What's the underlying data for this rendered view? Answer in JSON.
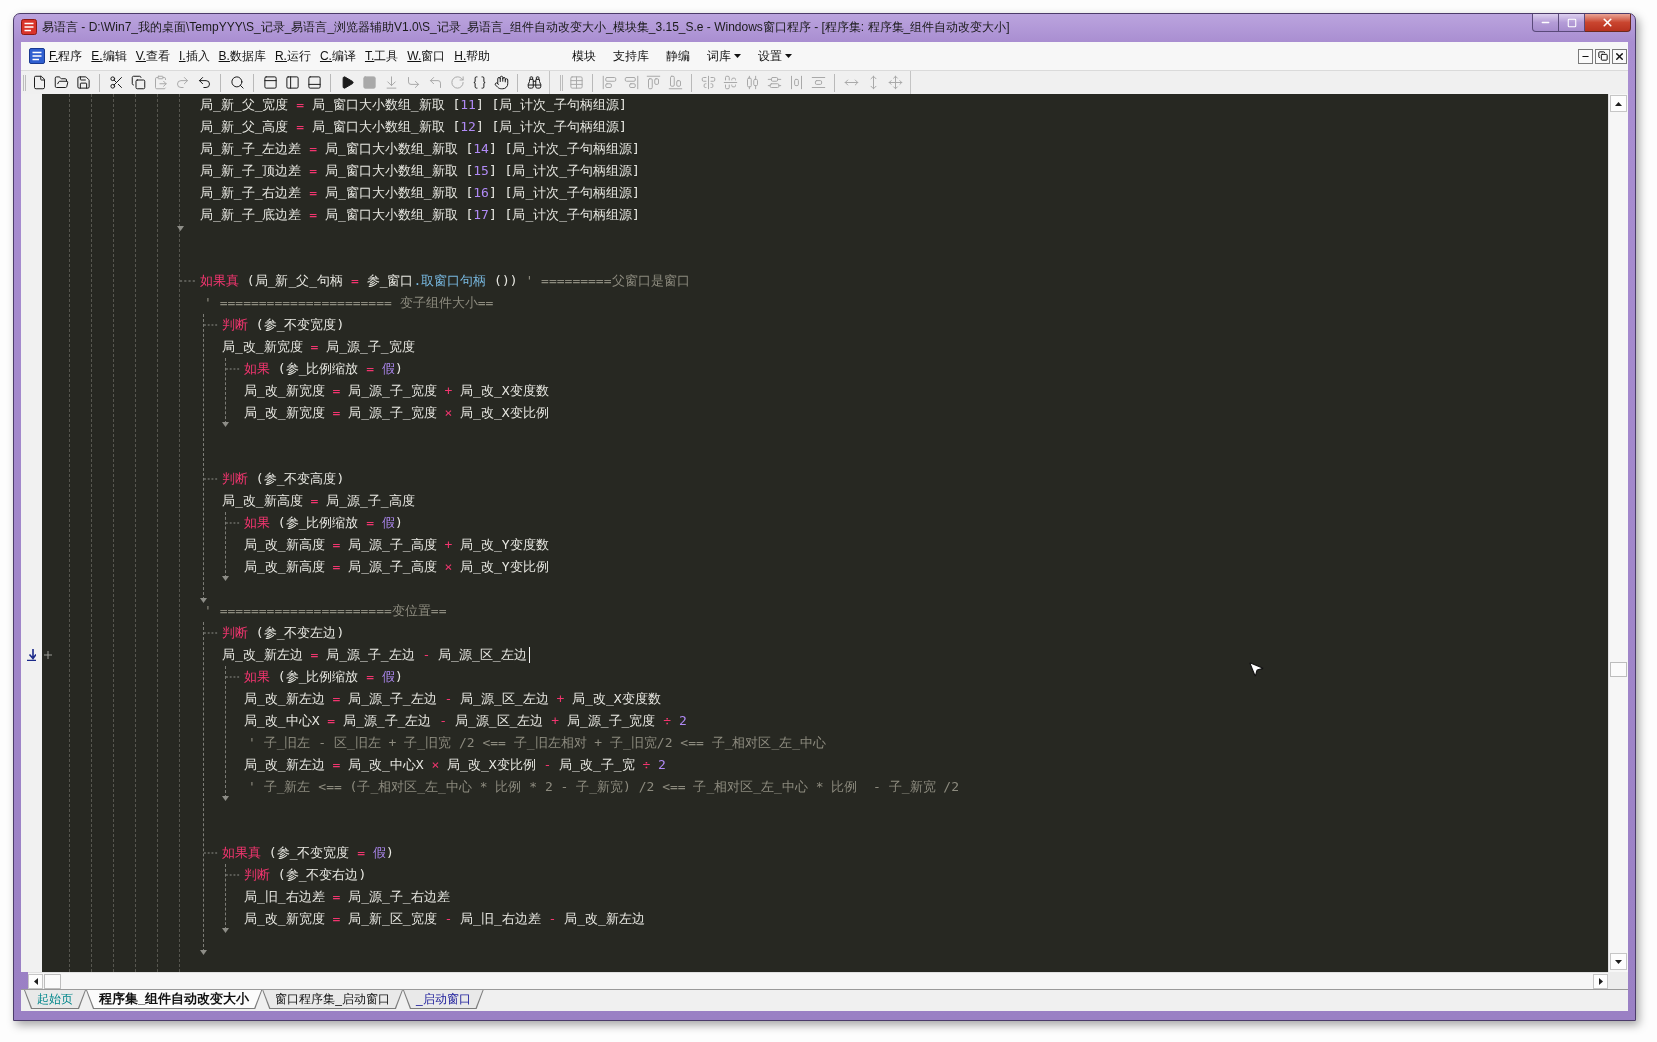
{
  "window": {
    "title": "易语言 - D:\\Win7_我的桌面\\TempYYY\\S_记录_易语言_浏览器辅助V1.0\\S_记录_易语言_组件自动改变大小_模块集_3.15_S.e - Windows窗口程序 - [程序集: 程序集_组件自动改变大小]"
  },
  "menu_bar": {
    "items": [
      "F.程序",
      "E.编辑",
      "V.查看",
      "I.插入",
      "B.数据库",
      "R.运行",
      "C.编译",
      "T.工具",
      "W.窗口",
      "H.帮助"
    ],
    "extras": [
      {
        "label": "模块",
        "dropdown": false
      },
      {
        "label": "支持库",
        "dropdown": false
      },
      {
        "label": "静编",
        "dropdown": false
      },
      {
        "label": "词库",
        "dropdown": true
      },
      {
        "label": "设置",
        "dropdown": true
      }
    ]
  },
  "toolbars": [
    {
      "groups": [
        {
          "buttons": [
            {
              "kind": "new",
              "disabled": false
            },
            {
              "kind": "open",
              "disabled": false
            },
            {
              "kind": "save",
              "disabled": false
            }
          ]
        },
        {
          "buttons": [
            {
              "kind": "cut",
              "disabled": false
            },
            {
              "kind": "copy",
              "disabled": false
            },
            {
              "kind": "paste",
              "disabled": true
            },
            {
              "kind": "redo",
              "disabled": true
            },
            {
              "kind": "undo",
              "disabled": false
            }
          ]
        },
        {
          "buttons": [
            {
              "kind": "find",
              "disabled": false
            }
          ]
        },
        {
          "buttons": [
            {
              "kind": "layout_top",
              "disabled": false
            },
            {
              "kind": "layout_left",
              "disabled": false
            },
            {
              "kind": "layout_bottom",
              "disabled": false
            }
          ]
        },
        {
          "buttons": [
            {
              "kind": "run",
              "disabled": false
            },
            {
              "kind": "stop",
              "disabled": true
            },
            {
              "kind": "step_into",
              "disabled": true
            },
            {
              "kind": "step_over",
              "disabled": true
            },
            {
              "kind": "step_out",
              "disabled": true
            },
            {
              "kind": "run_to_cursor",
              "disabled": true
            },
            {
              "kind": "braces",
              "disabled": false
            },
            {
              "kind": "hand",
              "disabled": false
            }
          ]
        },
        {
          "buttons": [
            {
              "kind": "binoculars",
              "disabled": false
            }
          ]
        }
      ]
    },
    {
      "groups": [
        {
          "buttons": [
            {
              "kind": "grid",
              "disabled": true
            }
          ]
        },
        {
          "buttons": [
            {
              "kind": "align_left",
              "disabled": true
            },
            {
              "kind": "align_right",
              "disabled": true
            },
            {
              "kind": "align_top",
              "disabled": true
            },
            {
              "kind": "align_bottom",
              "disabled": true
            }
          ]
        },
        {
          "buttons": [
            {
              "kind": "center_vertical",
              "disabled": true
            },
            {
              "kind": "center_horizontal",
              "disabled": true
            },
            {
              "kind": "distribute_horizontal",
              "disabled": true
            },
            {
              "kind": "distribute_vertical",
              "disabled": true
            },
            {
              "kind": "space_horizontal",
              "disabled": true
            },
            {
              "kind": "space_vertical",
              "disabled": true
            }
          ]
        },
        {
          "buttons": [
            {
              "kind": "same_width",
              "disabled": true
            },
            {
              "kind": "same_height",
              "disabled": true
            },
            {
              "kind": "same_size",
              "disabled": true
            }
          ]
        }
      ]
    }
  ],
  "editor": {
    "lines": [
      {
        "kind": "code",
        "current": false,
        "tokens": [
          {
            "text": "局_新_父_宽度",
            "kind": "text"
          },
          {
            "text": "=",
            "kind": "operator"
          },
          {
            "text": "局_窗口大小数组_新取",
            "kind": "text"
          },
          {
            "text": "[",
            "kind": "text"
          },
          {
            "text": "11",
            "kind": "number",
            "tight": true
          },
          {
            "text": "]",
            "kind": "text",
            "tight": true
          },
          {
            "text": "[局_计次_子句柄组源]",
            "kind": "text"
          }
        ]
      },
      {
        "kind": "code",
        "current": false,
        "tokens": [
          {
            "text": "局_新_父_高度",
            "kind": "text"
          },
          {
            "text": "=",
            "kind": "operator"
          },
          {
            "text": "局_窗口大小数组_新取",
            "kind": "text"
          },
          {
            "text": "[",
            "kind": "text"
          },
          {
            "text": "12",
            "kind": "number",
            "tight": true
          },
          {
            "text": "]",
            "kind": "text",
            "tight": true
          },
          {
            "text": "[局_计次_子句柄组源]",
            "kind": "text"
          }
        ]
      },
      {
        "kind": "code",
        "current": false,
        "tokens": [
          {
            "text": "局_新_子_左边差",
            "kind": "text"
          },
          {
            "text": "=",
            "kind": "operator"
          },
          {
            "text": "局_窗口大小数组_新取",
            "kind": "text"
          },
          {
            "text": "[",
            "kind": "text"
          },
          {
            "text": "14",
            "kind": "number",
            "tight": true
          },
          {
            "text": "]",
            "kind": "text",
            "tight": true
          },
          {
            "text": "[局_计次_子句柄组源]",
            "kind": "text"
          }
        ]
      },
      {
        "kind": "code",
        "current": false,
        "tokens": [
          {
            "text": "局_新_子_顶边差",
            "kind": "text"
          },
          {
            "text": "=",
            "kind": "operator"
          },
          {
            "text": "局_窗口大小数组_新取",
            "kind": "text"
          },
          {
            "text": "[",
            "kind": "text"
          },
          {
            "text": "15",
            "kind": "number",
            "tight": true
          },
          {
            "text": "]",
            "kind": "text",
            "tight": true
          },
          {
            "text": "[局_计次_子句柄组源]",
            "kind": "text"
          }
        ]
      },
      {
        "kind": "code",
        "current": false,
        "tokens": [
          {
            "text": "局_新_子_右边差",
            "kind": "text"
          },
          {
            "text": "=",
            "kind": "operator"
          },
          {
            "text": "局_窗口大小数组_新取",
            "kind": "text"
          },
          {
            "text": "[",
            "kind": "text"
          },
          {
            "text": "16",
            "kind": "number",
            "tight": true
          },
          {
            "text": "]",
            "kind": "text",
            "tight": true
          },
          {
            "text": "[局_计次_子句柄组源]",
            "kind": "text"
          }
        ]
      },
      {
        "kind": "code",
        "current": false,
        "tokens": [
          {
            "text": "局_新_子_底边差",
            "kind": "text"
          },
          {
            "text": "=",
            "kind": "operator"
          },
          {
            "text": "局_窗口大小数组_新取",
            "kind": "text"
          },
          {
            "text": "[",
            "kind": "text"
          },
          {
            "text": "17",
            "kind": "number",
            "tight": true
          },
          {
            "text": "]",
            "kind": "text",
            "tight": true
          },
          {
            "text": "[局_计次_子句柄组源]",
            "kind": "text"
          }
        ]
      },
      {
        "kind": "end"
      },
      {
        "kind": "blank"
      },
      {
        "kind": "flow",
        "current": false,
        "tokens": [
          {
            "text": "如果真",
            "kind": "keyword"
          },
          {
            "text": "(局_新_父_句柄",
            "kind": "text"
          },
          {
            "text": "=",
            "kind": "operator"
          },
          {
            "text": "参_窗口",
            "kind": "text"
          },
          {
            "text": ".取窗口句柄",
            "kind": "method",
            "tight": true
          },
          {
            "text": "())",
            "kind": "text"
          },
          {
            "text": "' =========父窗口是窗口",
            "kind": "comment"
          }
        ]
      },
      {
        "kind": "comment",
        "current": false,
        "tokens": [
          {
            "text": "' ====================== 变子组件大小==",
            "kind": "comment"
          }
        ],
        "children": [
          {
            "kind": "flow",
            "current": false,
            "tokens": [
              {
                "text": "判断",
                "kind": "keyword"
              },
              {
                "text": "(参_不变宽度)",
                "kind": "text"
              }
            ]
          },
          {
            "kind": "code",
            "current": false,
            "tokens": [
              {
                "text": "局_改_新宽度",
                "kind": "text"
              },
              {
                "text": "=",
                "kind": "operator"
              },
              {
                "text": "局_源_子_宽度",
                "kind": "text"
              }
            ],
            "children": [
              {
                "kind": "flow",
                "current": false,
                "tokens": [
                  {
                    "text": "如果",
                    "kind": "keyword"
                  },
                  {
                    "text": "(参_比例缩放",
                    "kind": "text"
                  },
                  {
                    "text": "=",
                    "kind": "operator"
                  },
                  {
                    "text": "假",
                    "kind": "constant"
                  },
                  {
                    "text": ")",
                    "kind": "text",
                    "tight": true
                  }
                ]
              },
              {
                "kind": "code",
                "current": false,
                "tokens": [
                  {
                    "text": "局_改_新宽度",
                    "kind": "text"
                  },
                  {
                    "text": "=",
                    "kind": "operator"
                  },
                  {
                    "text": "局_源_子_宽度",
                    "kind": "text"
                  },
                  {
                    "text": "+",
                    "kind": "operator"
                  },
                  {
                    "text": "局_改_X变度数",
                    "kind": "text"
                  }
                ]
              },
              {
                "kind": "code",
                "current": false,
                "tokens": [
                  {
                    "text": "局_改_新宽度",
                    "kind": "text"
                  },
                  {
                    "text": "=",
                    "kind": "operator"
                  },
                  {
                    "text": "局_源_子_宽度",
                    "kind": "text"
                  },
                  {
                    "text": "×",
                    "kind": "operator"
                  },
                  {
                    "text": "局_改_X变比例",
                    "kind": "text"
                  }
                ]
              }
            ]
          },
          {
            "kind": "blank"
          },
          {
            "kind": "blank"
          },
          {
            "kind": "flow",
            "current": false,
            "tokens": [
              {
                "text": "判断",
                "kind": "keyword"
              },
              {
                "text": "(参_不变高度)",
                "kind": "text"
              }
            ]
          },
          {
            "kind": "code",
            "current": false,
            "tokens": [
              {
                "text": "局_改_新高度",
                "kind": "text"
              },
              {
                "text": "=",
                "kind": "operator"
              },
              {
                "text": "局_源_子_高度",
                "kind": "text"
              }
            ],
            "children": [
              {
                "kind": "flow",
                "current": false,
                "tokens": [
                  {
                    "text": "如果",
                    "kind": "keyword"
                  },
                  {
                    "text": "(参_比例缩放",
                    "kind": "text"
                  },
                  {
                    "text": "=",
                    "kind": "operator"
                  },
                  {
                    "text": "假",
                    "kind": "constant"
                  },
                  {
                    "text": ")",
                    "kind": "text",
                    "tight": true
                  }
                ]
              },
              {
                "kind": "code",
                "current": false,
                "tokens": [
                  {
                    "text": "局_改_新高度",
                    "kind": "text"
                  },
                  {
                    "text": "=",
                    "kind": "operator"
                  },
                  {
                    "text": "局_源_子_高度",
                    "kind": "text"
                  },
                  {
                    "text": "+",
                    "kind": "operator"
                  },
                  {
                    "text": "局_改_Y变度数",
                    "kind": "text"
                  }
                ]
              },
              {
                "kind": "code",
                "current": false,
                "tokens": [
                  {
                    "text": "局_改_新高度",
                    "kind": "text"
                  },
                  {
                    "text": "=",
                    "kind": "operator"
                  },
                  {
                    "text": "局_源_子_高度",
                    "kind": "text"
                  },
                  {
                    "text": "×",
                    "kind": "operator"
                  },
                  {
                    "text": "局_改_Y变比例",
                    "kind": "text"
                  }
                ]
              }
            ]
          },
          {
            "kind": "blank"
          }
        ]
      },
      {
        "kind": "comment",
        "current": false,
        "tokens": [
          {
            "text": "' ======================变位置==",
            "kind": "comment"
          }
        ],
        "children": [
          {
            "kind": "flow",
            "current": false,
            "tokens": [
              {
                "text": "判断",
                "kind": "keyword"
              },
              {
                "text": "(参_不变左边)",
                "kind": "text"
              }
            ]
          },
          {
            "kind": "code",
            "current": true,
            "tokens": [
              {
                "text": "局_改_新左边",
                "kind": "text"
              },
              {
                "text": "=",
                "kind": "operator"
              },
              {
                "text": "局_源_子_左边",
                "kind": "text"
              },
              {
                "text": "-",
                "kind": "operator"
              },
              {
                "text": "局_源_区_左边",
                "kind": "text"
              }
            ],
            "children": [
              {
                "kind": "flow",
                "current": false,
                "tokens": [
                  {
                    "text": "如果",
                    "kind": "keyword"
                  },
                  {
                    "text": "(参_比例缩放",
                    "kind": "text"
                  },
                  {
                    "text": "=",
                    "kind": "operator"
                  },
                  {
                    "text": "假",
                    "kind": "constant"
                  },
                  {
                    "text": ")",
                    "kind": "text",
                    "tight": true
                  }
                ]
              },
              {
                "kind": "code",
                "current": false,
                "tokens": [
                  {
                    "text": "局_改_新左边",
                    "kind": "text"
                  },
                  {
                    "text": "=",
                    "kind": "operator"
                  },
                  {
                    "text": "局_源_子_左边",
                    "kind": "text"
                  },
                  {
                    "text": "-",
                    "kind": "operator"
                  },
                  {
                    "text": "局_源_区_左边",
                    "kind": "text"
                  },
                  {
                    "text": "+",
                    "kind": "operator"
                  },
                  {
                    "text": "局_改_X变度数",
                    "kind": "text"
                  }
                ]
              },
              {
                "kind": "code",
                "current": false,
                "tokens": [
                  {
                    "text": "局_改_中心X",
                    "kind": "text"
                  },
                  {
                    "text": "=",
                    "kind": "operator"
                  },
                  {
                    "text": "局_源_子_左边",
                    "kind": "text"
                  },
                  {
                    "text": "-",
                    "kind": "operator"
                  },
                  {
                    "text": "局_源_区_左边",
                    "kind": "text"
                  },
                  {
                    "text": "+",
                    "kind": "operator"
                  },
                  {
                    "text": "局_源_子_宽度",
                    "kind": "text"
                  },
                  {
                    "text": "÷",
                    "kind": "operator"
                  },
                  {
                    "text": "2",
                    "kind": "number"
                  }
                ]
              },
              {
                "kind": "comment",
                "current": false,
                "tokens": [
                  {
                    "text": "' 子_旧左 - 区_旧左 + 子_旧宽 /2 <== 子_旧左相对 + 子_旧宽/2 <== 子_相对区_左_中心",
                    "kind": "comment"
                  }
                ]
              },
              {
                "kind": "code",
                "current": false,
                "tokens": [
                  {
                    "text": "局_改_新左边",
                    "kind": "text"
                  },
                  {
                    "text": "=",
                    "kind": "operator"
                  },
                  {
                    "text": "局_改_中心X",
                    "kind": "text"
                  },
                  {
                    "text": "×",
                    "kind": "operator"
                  },
                  {
                    "text": "局_改_X变比例",
                    "kind": "text"
                  },
                  {
                    "text": "-",
                    "kind": "operator"
                  },
                  {
                    "text": "局_改_子_宽",
                    "kind": "text"
                  },
                  {
                    "text": "÷",
                    "kind": "operator"
                  },
                  {
                    "text": "2",
                    "kind": "number"
                  }
                ]
              },
              {
                "kind": "comment",
                "current": false,
                "tokens": [
                  {
                    "text": "' 子_新左 <== (子_相对区_左_中心 * 比例 * 2 - 子_新宽) /2 <== 子_相对区_左_中心 * 比例  - 子_新宽 /2",
                    "kind": "comment"
                  }
                ]
              }
            ]
          },
          {
            "kind": "blank"
          },
          {
            "kind": "blank"
          },
          {
            "kind": "flow",
            "current": false,
            "tokens": [
              {
                "text": "如果真",
                "kind": "keyword"
              },
              {
                "text": "(参_不变宽度",
                "kind": "text"
              },
              {
                "text": "=",
                "kind": "operator"
              },
              {
                "text": "假",
                "kind": "constant"
              },
              {
                "text": ")",
                "kind": "text",
                "tight": true
              }
            ],
            "children": [
              {
                "kind": "flow",
                "current": false,
                "tokens": [
                  {
                    "text": "判断",
                    "kind": "keyword"
                  },
                  {
                    "text": "(参_不变右边)",
                    "kind": "text"
                  }
                ]
              },
              {
                "kind": "code",
                "current": false,
                "tokens": [
                  {
                    "text": "局_旧_右边差",
                    "kind": "text"
                  },
                  {
                    "text": "=",
                    "kind": "operator"
                  },
                  {
                    "text": "局_源_子_右边差",
                    "kind": "text"
                  }
                ]
              },
              {
                "kind": "code",
                "current": false,
                "tokens": [
                  {
                    "text": "局_改_新宽度",
                    "kind": "text"
                  },
                  {
                    "text": "=",
                    "kind": "operator"
                  },
                  {
                    "text": "局_新_区_宽度",
                    "kind": "text"
                  },
                  {
                    "text": "-",
                    "kind": "operator"
                  },
                  {
                    "text": "局_旧_右边差",
                    "kind": "text"
                  },
                  {
                    "text": "-",
                    "kind": "operator"
                  },
                  {
                    "text": "局_改_新左边",
                    "kind": "text"
                  }
                ]
              }
            ]
          },
          {
            "kind": "blank"
          }
        ]
      },
      {
        "kind": "blank"
      }
    ]
  },
  "tabs": [
    {
      "label": "起始页",
      "kind": "start_page",
      "selected": false
    },
    {
      "label": "程序集_组件自动改变大小",
      "kind": "assembly",
      "selected": true
    },
    {
      "label": "窗口程序集_启动窗口",
      "kind": "window_assembly",
      "selected": false
    },
    {
      "label": "_启动窗口",
      "kind": "window",
      "selected": false
    }
  ]
}
